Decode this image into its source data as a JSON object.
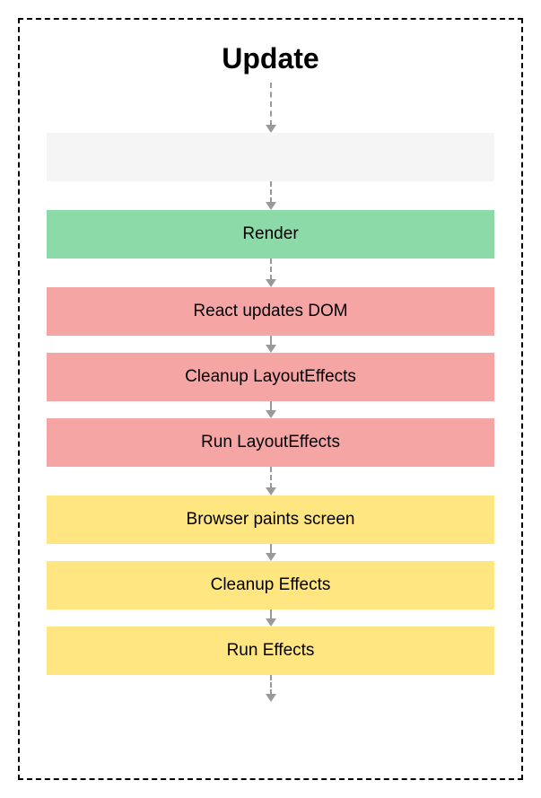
{
  "title": "Update",
  "steps": [
    {
      "label": "",
      "color": "empty"
    },
    {
      "label": "Render",
      "color": "green"
    },
    {
      "label": "React updates DOM",
      "color": "pink"
    },
    {
      "label": "Cleanup LayoutEffects",
      "color": "pink"
    },
    {
      "label": "Run LayoutEffects",
      "color": "pink"
    },
    {
      "label": "Browser paints screen",
      "color": "yellow"
    },
    {
      "label": "Cleanup Effects",
      "color": "yellow"
    },
    {
      "label": "Run Effects",
      "color": "yellow"
    }
  ],
  "colors": {
    "empty": "#f5f5f5",
    "green": "#8ddaa9",
    "pink": "#f6a5a5",
    "yellow": "#ffe680"
  }
}
